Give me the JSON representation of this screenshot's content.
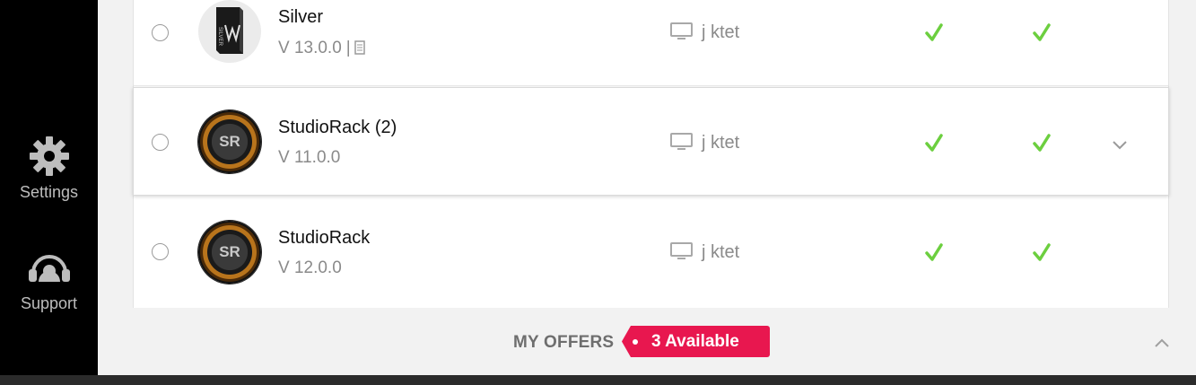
{
  "sidebar": {
    "settings": {
      "label": "Settings",
      "icon": "gear-icon"
    },
    "support": {
      "label": "Support",
      "icon": "headset-icon"
    }
  },
  "products": [
    {
      "name": "Silver",
      "version": "V 13.0.0",
      "version_sep": "|",
      "machine": "j ktet",
      "check1": true,
      "check2": true,
      "selected": false
    },
    {
      "name": "StudioRack (2)",
      "version": "V 11.0.0",
      "machine": "j ktet",
      "check1": true,
      "check2": true,
      "selected": true,
      "logo_text": "SR"
    },
    {
      "name": "StudioRack",
      "version": "V 12.0.0",
      "machine": "j ktet",
      "check1": true,
      "check2": true,
      "selected": false,
      "logo_text": "SR"
    }
  ],
  "offers": {
    "label": "MY OFFERS",
    "badge": "3 Available"
  },
  "colors": {
    "check": "#6ccf3f",
    "badge": "#e8174f",
    "sidebar_bg": "#000000"
  }
}
